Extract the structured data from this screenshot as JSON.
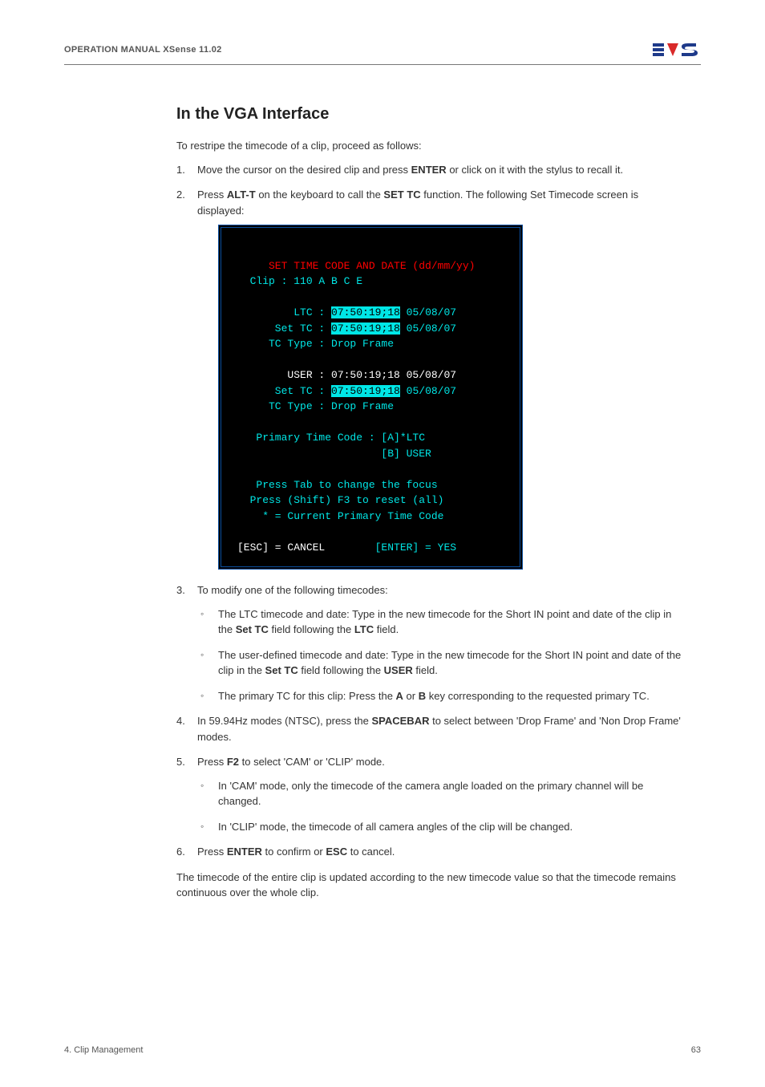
{
  "header": {
    "left": "OPERATION MANUAL XSense 11.02"
  },
  "section": {
    "heading": "In the VGA Interface",
    "intro": "To restripe the timecode of a clip, proceed as follows:",
    "steps": {
      "s1a": "Move the cursor on the desired clip and press ",
      "s1b": "ENTER",
      "s1c": " or click on it with the stylus to recall it.",
      "s2a": "Press ",
      "s2b": "ALT-T",
      "s2c": " on the keyboard to call the ",
      "s2d": "SET TC",
      "s2e": " function. The following Set Timecode screen is displayed:",
      "s3": "To modify one of the following timecodes:",
      "s3_1a": "The LTC timecode and date: Type in the new timecode for the Short IN point and date of the clip in the ",
      "s3_1b": "Set TC",
      "s3_1c": " field following the ",
      "s3_1d": "LTC",
      "s3_1e": " field.",
      "s3_2a": "The user-defined timecode and date: Type in the new timecode for the Short IN point and date of the clip in the ",
      "s3_2b": "Set TC",
      "s3_2c": " field following the ",
      "s3_2d": "USER",
      "s3_2e": " field.",
      "s3_3a": "The primary TC for this clip: Press the ",
      "s3_3b": "A",
      "s3_3c": " or ",
      "s3_3d": "B",
      "s3_3e": " key corresponding to the requested primary TC.",
      "s4a": "In 59.94Hz modes (NTSC), press the ",
      "s4b": "SPACEBAR",
      "s4c": " to select between 'Drop Frame' and 'Non Drop Frame' modes.",
      "s5a": "Press ",
      "s5b": "F2",
      "s5c": " to select 'CAM' or 'CLIP' mode.",
      "s5_1": "In 'CAM' mode, only the timecode of the camera angle loaded on the primary channel will be changed.",
      "s5_2": "In 'CLIP' mode, the timecode of all camera angles of the clip will be changed.",
      "s6a": "Press ",
      "s6b": "ENTER",
      "s6c": " to confirm or ",
      "s6d": "ESC",
      "s6e": " to cancel."
    },
    "closing": "The timecode of the entire clip is updated according to the new timecode value so that the timecode remains continuous over the whole clip."
  },
  "terminal": {
    "l1": "     SET TIME CODE AND DATE (dd/mm/yy)",
    "l2": "  Clip : 110 A B C E",
    "l3": "         LTC : ",
    "l3v": "07:50:19;18",
    "l3d": " 05/08/07",
    "l4": "      Set TC : ",
    "l4v": "07:50:19;18",
    "l4d": " 05/08/07",
    "l5": "     TC Type : Drop Frame",
    "l6": "        USER : 07:50:19;18 05/08/07",
    "l7": "      Set TC : ",
    "l7v": "07:50:19;18",
    "l7d": " 05/08/07",
    "l8": "     TC Type : Drop Frame",
    "l9": "   Primary Time Code : [A]*LTC",
    "l10": "                       [B] USER",
    "l11": "   Press Tab to change the focus",
    "l12": "  Press (Shift) F3 to reset (all)",
    "l13": "    * = Current Primary Time Code",
    "l14a": "[ESC] = CANCEL",
    "l14b": "        [ENTER] = YES"
  },
  "footer": {
    "left": "4. Clip Management",
    "right": "63"
  }
}
